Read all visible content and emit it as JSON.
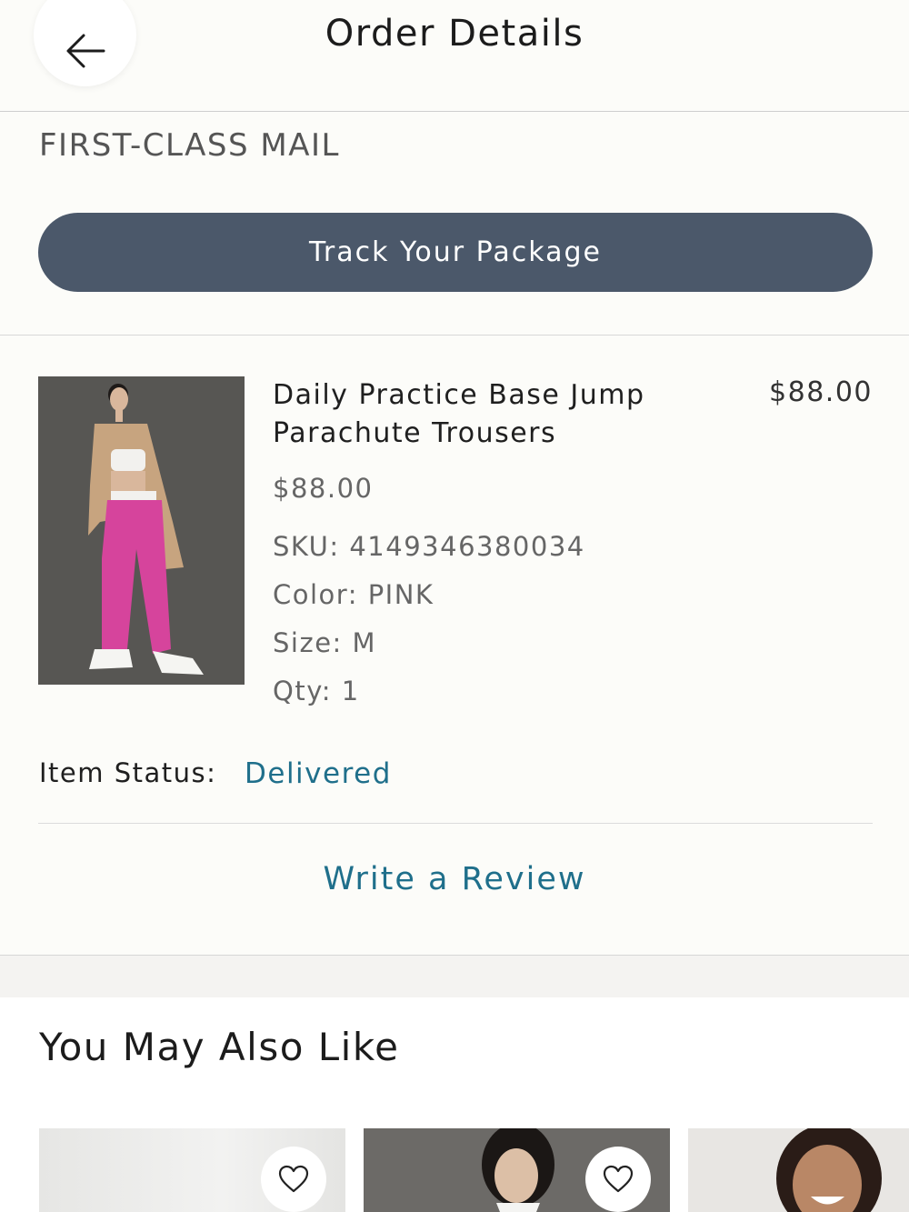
{
  "header": {
    "title": "Order Details",
    "back_icon": "arrow-left-icon"
  },
  "shipment": {
    "method": "FIRST-CLASS MAIL",
    "track_label": "Track Your Package"
  },
  "item": {
    "name": "Daily Practice  Base Jump Parachute Trousers",
    "total": "$88.00",
    "price": "$88.00",
    "sku": "SKU: 4149346380034",
    "color": "Color: PINK",
    "size": "Size: M",
    "qty": "Qty: 1",
    "status_label": "Item Status:",
    "status_value": "Delivered",
    "review_label": "Write a Review"
  },
  "recommendations": {
    "title": "You May Also Like",
    "cards": [
      {
        "favorite_icon": "heart-icon"
      },
      {
        "favorite_icon": "heart-icon"
      },
      {}
    ]
  },
  "colors": {
    "accent": "#1f6f8b",
    "button": "#4b586a"
  }
}
